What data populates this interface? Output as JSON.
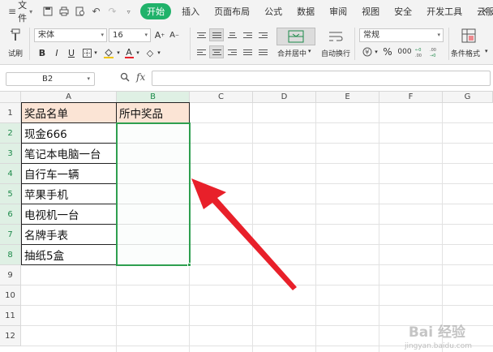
{
  "menu": {
    "file_label": "文件",
    "tabs": [
      {
        "label": "开始",
        "active": true
      },
      {
        "label": "插入"
      },
      {
        "label": "页面布局"
      },
      {
        "label": "公式"
      },
      {
        "label": "数据"
      },
      {
        "label": "审阅"
      },
      {
        "label": "视图"
      },
      {
        "label": "安全"
      },
      {
        "label": "开发工具"
      },
      {
        "label": "云服务"
      }
    ],
    "accent_color": "#20b26a"
  },
  "ribbon": {
    "format_painter_label": "试刷",
    "font_name": "宋体",
    "font_size": "16",
    "merge_center_label": "合并居中",
    "wrap_text_label": "自动换行",
    "number_format": "常规",
    "number_percent": "%",
    "number_thousands": "000",
    "conditional_format_label": "条件格式",
    "bold": "B",
    "italic": "I",
    "underline": "U"
  },
  "formula_bar": {
    "cell_ref": "B2",
    "fx_label": "fx",
    "formula_value": ""
  },
  "sheet": {
    "columns": [
      "A",
      "B",
      "C",
      "D",
      "E",
      "F",
      "G"
    ],
    "rows": [
      "1",
      "2",
      "3",
      "4",
      "5",
      "6",
      "7",
      "8",
      "9",
      "10",
      "11",
      "12"
    ],
    "selected_column": "B",
    "selected_range": "B2:B8",
    "cells": {
      "A1": "奖品名单",
      "B1": "所中奖品",
      "A2": "现金666",
      "A3": "笔记本电脑一台",
      "A4": "自行车一辆",
      "A5": "苹果手机",
      "A6": "电视机一台",
      "A7": "名牌手表",
      "A8": "抽纸5盒"
    },
    "header_fill_color": "#fbe4d5",
    "selection_color": "#2e9f4f",
    "annotation_arrow_color": "#e8202a"
  },
  "watermark": {
    "text": "Bai 经验",
    "sub": "jingyan.baidu.com"
  }
}
